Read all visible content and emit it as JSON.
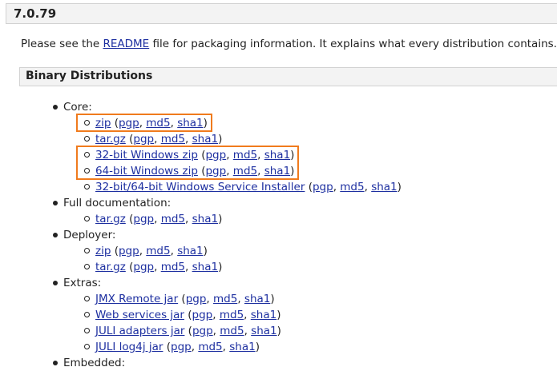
{
  "version": "7.0.79",
  "intro": {
    "before": "Please see the ",
    "link": "README",
    "after": " file for packaging information. It explains what every distribution contains."
  },
  "section_title": "Binary Distributions",
  "groups": [
    {
      "label": "Core:",
      "items": [
        {
          "name": "zip",
          "sigs": [
            "pgp",
            "md5",
            "sha1"
          ],
          "highlighted": true
        },
        {
          "name": "tar.gz",
          "sigs": [
            "pgp",
            "md5",
            "sha1"
          ],
          "highlighted": false
        },
        {
          "name": "32-bit Windows zip",
          "sigs": [
            "pgp",
            "md5",
            "sha1"
          ],
          "highlighted": true
        },
        {
          "name": "64-bit Windows zip",
          "sigs": [
            "pgp",
            "md5",
            "sha1"
          ],
          "highlighted": true
        },
        {
          "name": "32-bit/64-bit Windows Service Installer",
          "sigs": [
            "pgp",
            "md5",
            "sha1"
          ],
          "highlighted": false
        }
      ]
    },
    {
      "label": "Full documentation:",
      "items": [
        {
          "name": "tar.gz",
          "sigs": [
            "pgp",
            "md5",
            "sha1"
          ],
          "highlighted": false
        }
      ]
    },
    {
      "label": "Deployer:",
      "items": [
        {
          "name": "zip",
          "sigs": [
            "pgp",
            "md5",
            "sha1"
          ],
          "highlighted": false
        },
        {
          "name": "tar.gz",
          "sigs": [
            "pgp",
            "md5",
            "sha1"
          ],
          "highlighted": false
        }
      ]
    },
    {
      "label": "Extras:",
      "items": [
        {
          "name": "JMX Remote jar",
          "sigs": [
            "pgp",
            "md5",
            "sha1"
          ],
          "highlighted": false
        },
        {
          "name": "Web services jar",
          "sigs": [
            "pgp",
            "md5",
            "sha1"
          ],
          "highlighted": false
        },
        {
          "name": "JULI adapters jar",
          "sigs": [
            "pgp",
            "md5",
            "sha1"
          ],
          "highlighted": false
        },
        {
          "name": "JULI log4j jar",
          "sigs": [
            "pgp",
            "md5",
            "sha1"
          ],
          "highlighted": false
        }
      ]
    },
    {
      "label": "Embedded:",
      "items": []
    }
  ],
  "colors": {
    "link": "#1d2fa0",
    "highlight": "#f07b1d",
    "bar_bg": "#f3f3f3"
  }
}
